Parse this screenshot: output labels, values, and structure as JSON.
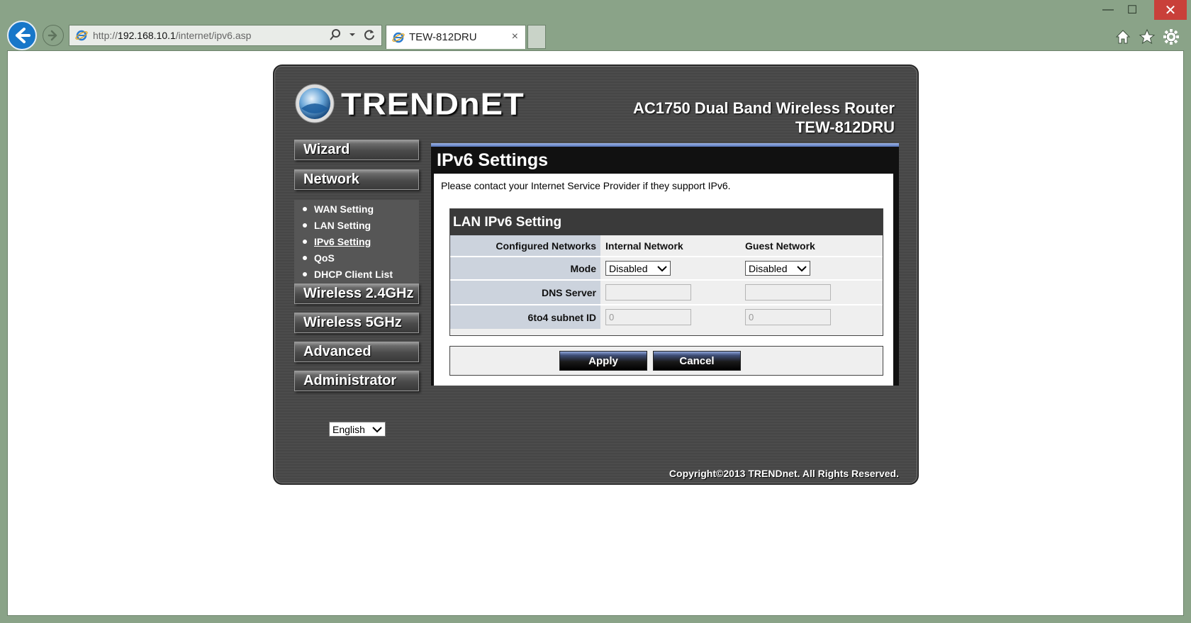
{
  "browser": {
    "url_prefix": "http://",
    "url_host": "192.168.10.1",
    "url_path": "/internet/ipv6.asp",
    "tab_title": "TEW-812DRU",
    "window_controls": {
      "minimize": "—",
      "maximize": "☐",
      "close": "✕"
    },
    "tab_close": "×"
  },
  "header": {
    "logo_text": "TRENDnET",
    "product_line1": "AC1750 Dual Band Wireless Router",
    "product_line2": "TEW-812DRU"
  },
  "sidebar": {
    "wizard": "Wizard",
    "network": "Network",
    "network_items": [
      {
        "label": "WAN Setting"
      },
      {
        "label": "LAN Setting"
      },
      {
        "label": "IPv6 Setting"
      },
      {
        "label": "QoS"
      },
      {
        "label": "DHCP Client List"
      }
    ],
    "wireless24": "Wireless 2.4GHz",
    "wireless5": "Wireless 5GHz",
    "advanced": "Advanced",
    "administrator": "Administrator",
    "language": "English"
  },
  "content": {
    "title": "IPv6 Settings",
    "notice": "Please contact your Internet Service Provider if they support IPv6.",
    "lan": {
      "title": "LAN IPv6 Setting",
      "configured_networks_label": "Configured Networks",
      "internal_network": "Internal Network",
      "guest_network": "Guest Network",
      "mode_label": "Mode",
      "mode_internal": "Disabled",
      "mode_guest": "Disabled",
      "dns_label": "DNS Server",
      "dns_internal": "",
      "dns_guest": "",
      "subnet_label": "6to4 subnet ID",
      "subnet_internal": "0",
      "subnet_guest": "0"
    },
    "apply": "Apply",
    "cancel": "Cancel"
  },
  "footer": {
    "copyright": "Copyright©2013 TRENDnet. All Rights Reserved."
  },
  "colors": {
    "chrome": "#8aa388",
    "accent_blue": "#1877c9",
    "panel": "#4c4c4c",
    "label_cell": "#ccd3dd"
  }
}
